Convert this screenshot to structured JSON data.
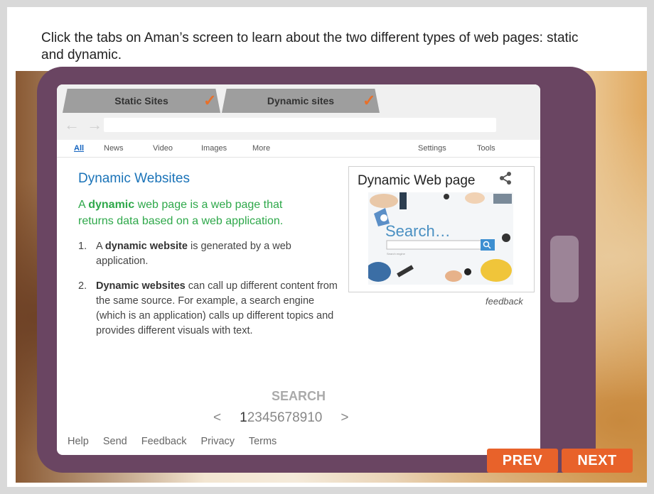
{
  "instruction": "Click the tabs on Aman’s screen to learn about the two different types of web pages: static and dynamic.",
  "tabs": [
    {
      "label": "Static Sites"
    },
    {
      "label": "Dynamic sites"
    }
  ],
  "nav_arrows": "← →",
  "menu": {
    "all": "All",
    "news": "News",
    "video": "Video",
    "images": "Images",
    "more": "More",
    "settings": "Settings",
    "tools": "Tools"
  },
  "article": {
    "title": "Dynamic Websites",
    "lead_pre": "A ",
    "lead_bold": "dynamic",
    "lead_post": " web page is a web page that returns data based on a web application.",
    "items": [
      {
        "num": "1.",
        "pre": "A ",
        "bold": "dynamic website",
        "post": " is generated by a web application."
      },
      {
        "num": "2.",
        "pre": "",
        "bold": "Dynamic websites",
        "post": " can call up different content from the same source. For example, a search engine (which is an application) calls up different topics and provides different visuals with text."
      }
    ]
  },
  "card": {
    "title": "Dynamic Web page",
    "image_text": "Search…",
    "image_caption": "Search engine"
  },
  "feedback": "feedback",
  "search_label": "SEARCH",
  "pager": {
    "prev": "<",
    "current": "1",
    "rest": "2345678910",
    "next": ">"
  },
  "footer": [
    "Help",
    "Send",
    "Feedback",
    "Privacy",
    "Terms"
  ],
  "buttons": {
    "prev": "PREV",
    "next": "NEXT"
  },
  "colors": {
    "tablet": "#6a4562",
    "button": "#e8622a",
    "title": "#1a73b8",
    "lead": "#2ea84a"
  }
}
